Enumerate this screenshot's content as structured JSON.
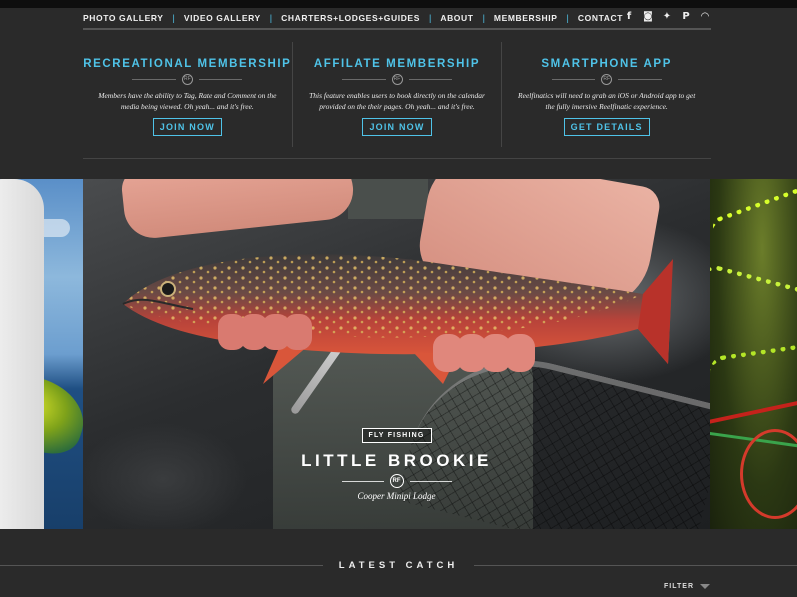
{
  "nav": {
    "links": [
      "PHOTO GALLERY",
      "VIDEO GALLERY",
      "CHARTERS+LODGES+GUIDES",
      "ABOUT",
      "MEMBERSHIP",
      "CONTACT"
    ],
    "separator": "|",
    "social": [
      {
        "icon": "facebook-icon",
        "glyph": "f"
      },
      {
        "icon": "instagram-icon",
        "glyph": "◙"
      },
      {
        "icon": "twitter-icon",
        "glyph": "✦"
      },
      {
        "icon": "pinterest-icon",
        "glyph": "P"
      },
      {
        "icon": "rss-icon",
        "glyph": "◠"
      }
    ]
  },
  "memberships": [
    {
      "title": "RECREATIONAL MEMBERSHIP",
      "description": "Members have the ability to Tag, Rate and Comment on the media being viewed. Oh yeah... and it's free.",
      "button": "JOIN NOW"
    },
    {
      "title": "AFFILATE MEMBERSHIP",
      "description": "This feature enables users to book directly on the calendar provided on the their pages. Oh yeah... and it's free.",
      "button": "JOIN NOW"
    },
    {
      "title": "SMARTPHONE APP",
      "description": "Reelfinatics will need to grab an iOS or Android app to get the fully imersive Reelfinatic experience.",
      "button": "GET DETAILS"
    }
  ],
  "emblem_text": "RF",
  "slide": {
    "category": "FLY FISHING",
    "title": "LITTLE BROOKIE",
    "subtitle": "Cooper Minipi Lodge"
  },
  "latest": {
    "title": "LATEST CATCH",
    "filter_label": "FILTER"
  },
  "colors": {
    "accent": "#4fc3e8",
    "background": "#2a2a2a",
    "topbar": "#0e0e0e"
  }
}
